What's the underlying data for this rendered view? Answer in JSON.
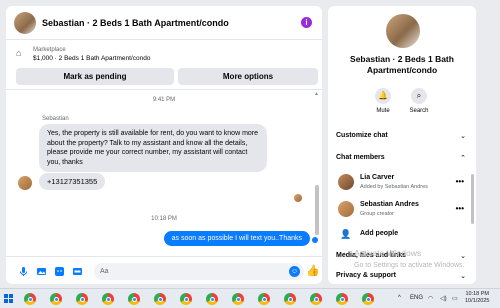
{
  "chat": {
    "title": "Sebastian · 2 Beds 1 Bath Apartment/condo",
    "info_icon": "i",
    "listing": {
      "category": "Marketplace",
      "price_line": "$1,000 · 2 Beds 1 Bath Apartment/condo",
      "pending_label": "Mark as pending",
      "more_label": "More options"
    },
    "time1": "9:41 PM",
    "sender": "Sebastian",
    "message_in": "Yes, the property is still available for rent, do you want to know more about the property? Talk to my assistant and know all the details, please provide me your correct number, my assistant will contact you, thanks",
    "message_phone": "+13127351355",
    "time2": "10:18 PM",
    "message_out": "as soon as possible I will text you..Thanks",
    "composer_placeholder": "Aa"
  },
  "side": {
    "title": "Sebastian · 2 Beds 1 Bath Apartment/condo",
    "mute_label": "Mute",
    "search_label": "Search",
    "customize_label": "Customize chat",
    "members_label": "Chat members",
    "members": [
      {
        "name": "Lia Carver",
        "sub": "Added by Sebastian Andres"
      },
      {
        "name": "Sebastian Andres",
        "sub": "Group creator"
      }
    ],
    "add_people_label": "Add people",
    "media_label": "Media, files and links",
    "privacy_label": "Privacy & support"
  },
  "watermark": {
    "line1": "Activate Windows",
    "line2": "Go to Settings to activate Windows."
  },
  "taskbar": {
    "time": "10:18 PM",
    "date": "10/1/2025",
    "lang": "ENG",
    "app_count": 14
  },
  "colors": {
    "messenger_blue": "#0a7cff",
    "bubble_gray": "#e4e6eb",
    "info_purple": "#9b2bd8"
  }
}
